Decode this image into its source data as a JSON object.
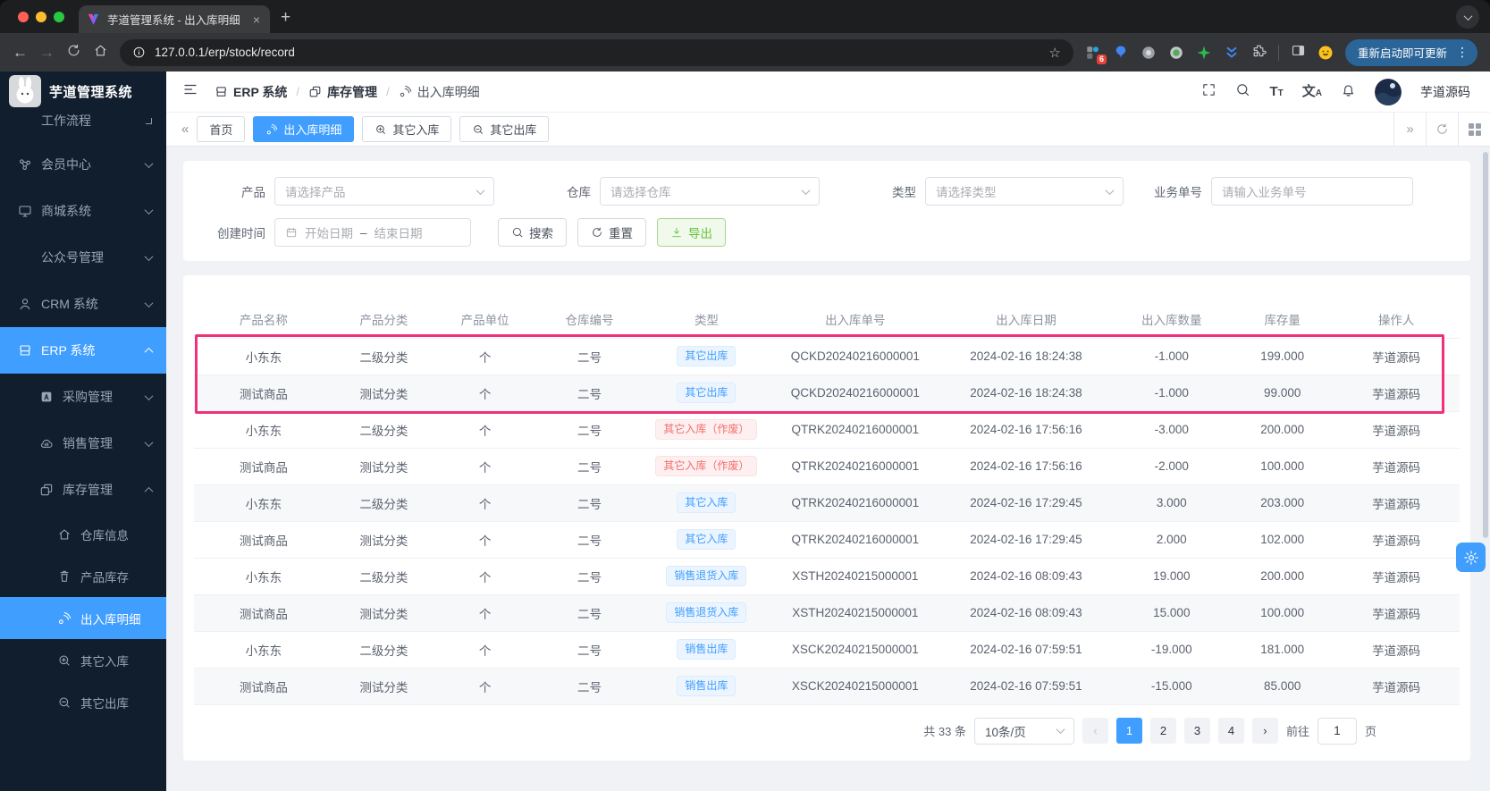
{
  "browser": {
    "tab_title": "芋道管理系统 - 出入库明细",
    "url": "127.0.0.1/erp/stock/record",
    "extension_badge": "6",
    "update_button": "重新启动即可更新"
  },
  "sidebar": {
    "app_title": "芋道管理系统",
    "menu": [
      {
        "id": "workflow",
        "label": "工作流程",
        "level": 1,
        "chevron": "down",
        "cut": true,
        "indent": true
      },
      {
        "id": "member-center",
        "label": "会员中心",
        "icon": "member",
        "level": 1,
        "chevron": "down"
      },
      {
        "id": "mall-system",
        "label": "商城系统",
        "icon": "mall",
        "level": 1,
        "chevron": "down"
      },
      {
        "id": "official-account",
        "label": "公众号管理",
        "level": 1,
        "chevron": "down",
        "indent": true
      },
      {
        "id": "crm-system",
        "label": "CRM 系统",
        "icon": "user",
        "level": 1,
        "chevron": "down"
      },
      {
        "id": "erp-system",
        "label": "ERP 系统",
        "icon": "shop",
        "level": 1,
        "chevron": "up",
        "active": true
      },
      {
        "id": "purchase-management",
        "label": "采购管理",
        "icon": "purchase",
        "level": 2,
        "chevron": "down"
      },
      {
        "id": "sales-management",
        "label": "销售管理",
        "icon": "sales",
        "level": 2,
        "chevron": "down"
      },
      {
        "id": "stock-management",
        "label": "库存管理",
        "icon": "stock",
        "level": 2,
        "chevron": "up"
      },
      {
        "id": "warehouse-info",
        "label": "仓库信息",
        "icon": "house",
        "level": 3
      },
      {
        "id": "product-stock",
        "label": "产品库存",
        "icon": "cup",
        "level": 3
      },
      {
        "id": "stock-record",
        "label": "出入库明细",
        "icon": "record",
        "level": 3,
        "active": true
      },
      {
        "id": "other-stock-in",
        "label": "其它入库",
        "icon": "zoomin",
        "level": 3
      },
      {
        "id": "other-stock-out",
        "label": "其它出库",
        "icon": "zoomout",
        "level": 3
      }
    ]
  },
  "header": {
    "breadcrumb": [
      {
        "label": "ERP 系统",
        "icon": "shop"
      },
      {
        "label": "库存管理",
        "icon": "stock"
      },
      {
        "label": "出入库明细",
        "icon": "record"
      }
    ],
    "username": "芋道源码"
  },
  "tabbar": {
    "tabs": [
      {
        "id": "home",
        "label": "首页"
      },
      {
        "id": "stock-record",
        "label": "出入库明细",
        "icon": "record",
        "active": true
      },
      {
        "id": "other-stock-in",
        "label": "其它入库",
        "icon": "zoomin"
      },
      {
        "id": "other-stock-out",
        "label": "其它出库",
        "icon": "zoomout"
      }
    ]
  },
  "filters": {
    "product_label": "产品",
    "product_placeholder": "请选择产品",
    "warehouse_label": "仓库",
    "warehouse_placeholder": "请选择仓库",
    "type_label": "类型",
    "type_placeholder": "请选择类型",
    "biz_no_label": "业务单号",
    "biz_no_placeholder": "请输入业务单号",
    "create_time_label": "创建时间",
    "date_start_placeholder": "开始日期",
    "date_separator": "–",
    "date_end_placeholder": "结束日期",
    "search_button": "搜索",
    "reset_button": "重置",
    "export_button": "导出"
  },
  "table": {
    "columns": [
      "产品名称",
      "产品分类",
      "产品单位",
      "仓库编号",
      "类型",
      "出入库单号",
      "出入库日期",
      "出入库数量",
      "库存量",
      "操作人"
    ],
    "rows": [
      {
        "product": "小东东",
        "category": "二级分类",
        "unit": "个",
        "warehouse": "二号",
        "type": "其它出库",
        "variant": "info",
        "order_no": "QCKD20240216000001",
        "datetime": "2024-02-16 18:24:38",
        "qty": "-1.000",
        "stock": "199.000",
        "operator": "芋道源码",
        "striped": false
      },
      {
        "product": "测试商品",
        "category": "测试分类",
        "unit": "个",
        "warehouse": "二号",
        "type": "其它出库",
        "variant": "info",
        "order_no": "QCKD20240216000001",
        "datetime": "2024-02-16 18:24:38",
        "qty": "-1.000",
        "stock": "99.000",
        "operator": "芋道源码",
        "striped": true
      },
      {
        "product": "小东东",
        "category": "二级分类",
        "unit": "个",
        "warehouse": "二号",
        "type": "其它入库（作废）",
        "variant": "danger",
        "order_no": "QTRK20240216000001",
        "datetime": "2024-02-16 17:56:16",
        "qty": "-3.000",
        "stock": "200.000",
        "operator": "芋道源码",
        "striped": false
      },
      {
        "product": "测试商品",
        "category": "测试分类",
        "unit": "个",
        "warehouse": "二号",
        "type": "其它入库（作废）",
        "variant": "danger",
        "order_no": "QTRK20240216000001",
        "datetime": "2024-02-16 17:56:16",
        "qty": "-2.000",
        "stock": "100.000",
        "operator": "芋道源码",
        "striped": false
      },
      {
        "product": "小东东",
        "category": "二级分类",
        "unit": "个",
        "warehouse": "二号",
        "type": "其它入库",
        "variant": "info",
        "order_no": "QTRK20240216000001",
        "datetime": "2024-02-16 17:29:45",
        "qty": "3.000",
        "stock": "203.000",
        "operator": "芋道源码",
        "striped": true
      },
      {
        "product": "测试商品",
        "category": "测试分类",
        "unit": "个",
        "warehouse": "二号",
        "type": "其它入库",
        "variant": "info",
        "order_no": "QTRK20240216000001",
        "datetime": "2024-02-16 17:29:45",
        "qty": "2.000",
        "stock": "102.000",
        "operator": "芋道源码",
        "striped": false
      },
      {
        "product": "小东东",
        "category": "二级分类",
        "unit": "个",
        "warehouse": "二号",
        "type": "销售退货入库",
        "variant": "info",
        "order_no": "XSTH20240215000001",
        "datetime": "2024-02-16 08:09:43",
        "qty": "19.000",
        "stock": "200.000",
        "operator": "芋道源码",
        "striped": false
      },
      {
        "product": "测试商品",
        "category": "测试分类",
        "unit": "个",
        "warehouse": "二号",
        "type": "销售退货入库",
        "variant": "info",
        "order_no": "XSTH20240215000001",
        "datetime": "2024-02-16 08:09:43",
        "qty": "15.000",
        "stock": "100.000",
        "operator": "芋道源码",
        "striped": true
      },
      {
        "product": "小东东",
        "category": "二级分类",
        "unit": "个",
        "warehouse": "二号",
        "type": "销售出库",
        "variant": "info",
        "order_no": "XSCK20240215000001",
        "datetime": "2024-02-16 07:59:51",
        "qty": "-19.000",
        "stock": "181.000",
        "operator": "芋道源码",
        "striped": false
      },
      {
        "product": "测试商品",
        "category": "测试分类",
        "unit": "个",
        "warehouse": "二号",
        "type": "销售出库",
        "variant": "info",
        "order_no": "XSCK20240215000001",
        "datetime": "2024-02-16 07:59:51",
        "qty": "-15.000",
        "stock": "85.000",
        "operator": "芋道源码",
        "striped": true
      }
    ],
    "highlighted_rows": [
      1,
      2
    ]
  },
  "pagination": {
    "total": "共 33 条",
    "page_size": "10条/页",
    "pages": [
      "1",
      "2",
      "3",
      "4"
    ],
    "active_page": "1",
    "goto_label": "前往",
    "goto_value": "1",
    "unit_label": "页"
  },
  "colors": {
    "primary": "#409eff",
    "highlight_pink": "#ef3179",
    "export_green": "#67c23a",
    "badge_info_bg": "#ecf5ff",
    "badge_danger_bg": "#fef0f0",
    "sidebar_bg": "#101e2d"
  }
}
